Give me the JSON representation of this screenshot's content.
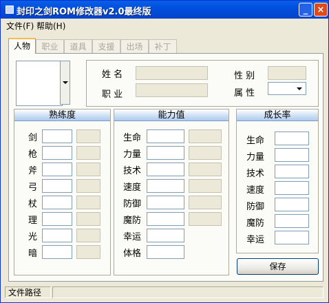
{
  "window": {
    "title": "封印之剑ROM修改器v2.0最终版",
    "minimize_glyph": "_",
    "close_glyph": "×"
  },
  "menu": [
    {
      "label": "文件(F)"
    },
    {
      "label": "帮助(H)"
    }
  ],
  "tabs": [
    {
      "label": "人物",
      "active": true
    },
    {
      "label": "职业",
      "active": false
    },
    {
      "label": "道具",
      "active": false
    },
    {
      "label": "支援",
      "active": false
    },
    {
      "label": "出场",
      "active": false
    },
    {
      "label": "补丁",
      "active": false
    }
  ],
  "info": {
    "name_label": "姓 名",
    "class_label": "职 业",
    "gender_label": "性 别",
    "attr_label": "属 性"
  },
  "proficiency": {
    "title": "熟练度",
    "rows": [
      {
        "label": "剑"
      },
      {
        "label": "枪"
      },
      {
        "label": "斧"
      },
      {
        "label": "弓"
      },
      {
        "label": "杖"
      },
      {
        "label": "理"
      },
      {
        "label": "光"
      },
      {
        "label": "暗"
      }
    ]
  },
  "stats": {
    "title": "能力值",
    "rows": [
      {
        "label": "生命",
        "has_second": true
      },
      {
        "label": "力量",
        "has_second": true
      },
      {
        "label": "技术",
        "has_second": true
      },
      {
        "label": "速度",
        "has_second": true
      },
      {
        "label": "防御",
        "has_second": true
      },
      {
        "label": "魔防",
        "has_second": true
      },
      {
        "label": "幸运",
        "has_second": false
      },
      {
        "label": "体格",
        "has_second": false
      }
    ]
  },
  "growth": {
    "title": "成长率",
    "rows": [
      {
        "label": "生命"
      },
      {
        "label": "力量"
      },
      {
        "label": "技术"
      },
      {
        "label": "速度"
      },
      {
        "label": "防御"
      },
      {
        "label": "魔防"
      },
      {
        "label": "幸运"
      }
    ]
  },
  "save_label": "保存",
  "status": {
    "file_path_label": "文件路径"
  }
}
